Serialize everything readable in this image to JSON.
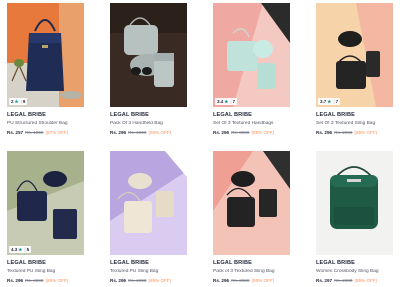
{
  "products": [
    {
      "brand": "LEGAL BRIBE",
      "name": "PU Structured Shoulder Bag",
      "price": "Rs. 257",
      "mrp": "Rs. 1999",
      "discount": "(87% OFF)",
      "rating": "2",
      "rating_count": "9",
      "image": "navy-shoulder-bag"
    },
    {
      "brand": "LEGAL BRIBE",
      "name": "Pack Of 3 Handheld Bag",
      "price": "Rs. 296",
      "mrp": "Rs. 2000",
      "discount": "(85% OFF)",
      "rating": "",
      "rating_count": "",
      "image": "grey-bag-set"
    },
    {
      "brand": "LEGAL BRIBE",
      "name": "Set Of 3 Textured Handbags",
      "price": "Rs. 296",
      "mrp": "Rs. 2000",
      "discount": "(85% OFF)",
      "rating": "3.4",
      "rating_count": "7",
      "image": "mint-bag-set"
    },
    {
      "brand": "LEGAL BRIBE",
      "name": "Set Of 3 Textured Sling Bag",
      "price": "Rs. 296",
      "mrp": "Rs. 2000",
      "discount": "(85% OFF)",
      "rating": "3.7",
      "rating_count": "7",
      "image": "black-bag-set"
    },
    {
      "brand": "LEGAL BRIBE",
      "name": "Textured PU Sling Bag",
      "price": "Rs. 296",
      "mrp": "Rs. 2000",
      "discount": "(85% OFF)",
      "rating": "4.3",
      "rating_count": "5",
      "image": "navy-bag-set"
    },
    {
      "brand": "LEGAL BRIBE",
      "name": "Textured PU Sling Bag",
      "price": "Rs. 296",
      "mrp": "Rs. 2000",
      "discount": "(85% OFF)",
      "rating": "",
      "rating_count": "",
      "image": "beige-bag-set"
    },
    {
      "brand": "LEGAL BRIBE",
      "name": "Pack of 3 Textured Sling Bag",
      "price": "Rs. 296",
      "mrp": "Rs. 2000",
      "discount": "(85% OFF)",
      "rating": "",
      "rating_count": "",
      "image": "black-sling-set"
    },
    {
      "brand": "LEGAL BRIBE",
      "name": "Women Crossbody Sling Bag",
      "price": "Rs. 297",
      "mrp": "Rs. 2000",
      "discount": "(85% OFF)",
      "rating": "",
      "rating_count": "",
      "image": "green-crossbody-bag"
    }
  ],
  "colors": {
    "rating_star": "#14958f",
    "discount": "#ff905a",
    "brand_text": "#282c3f",
    "name_text": "#535766"
  }
}
